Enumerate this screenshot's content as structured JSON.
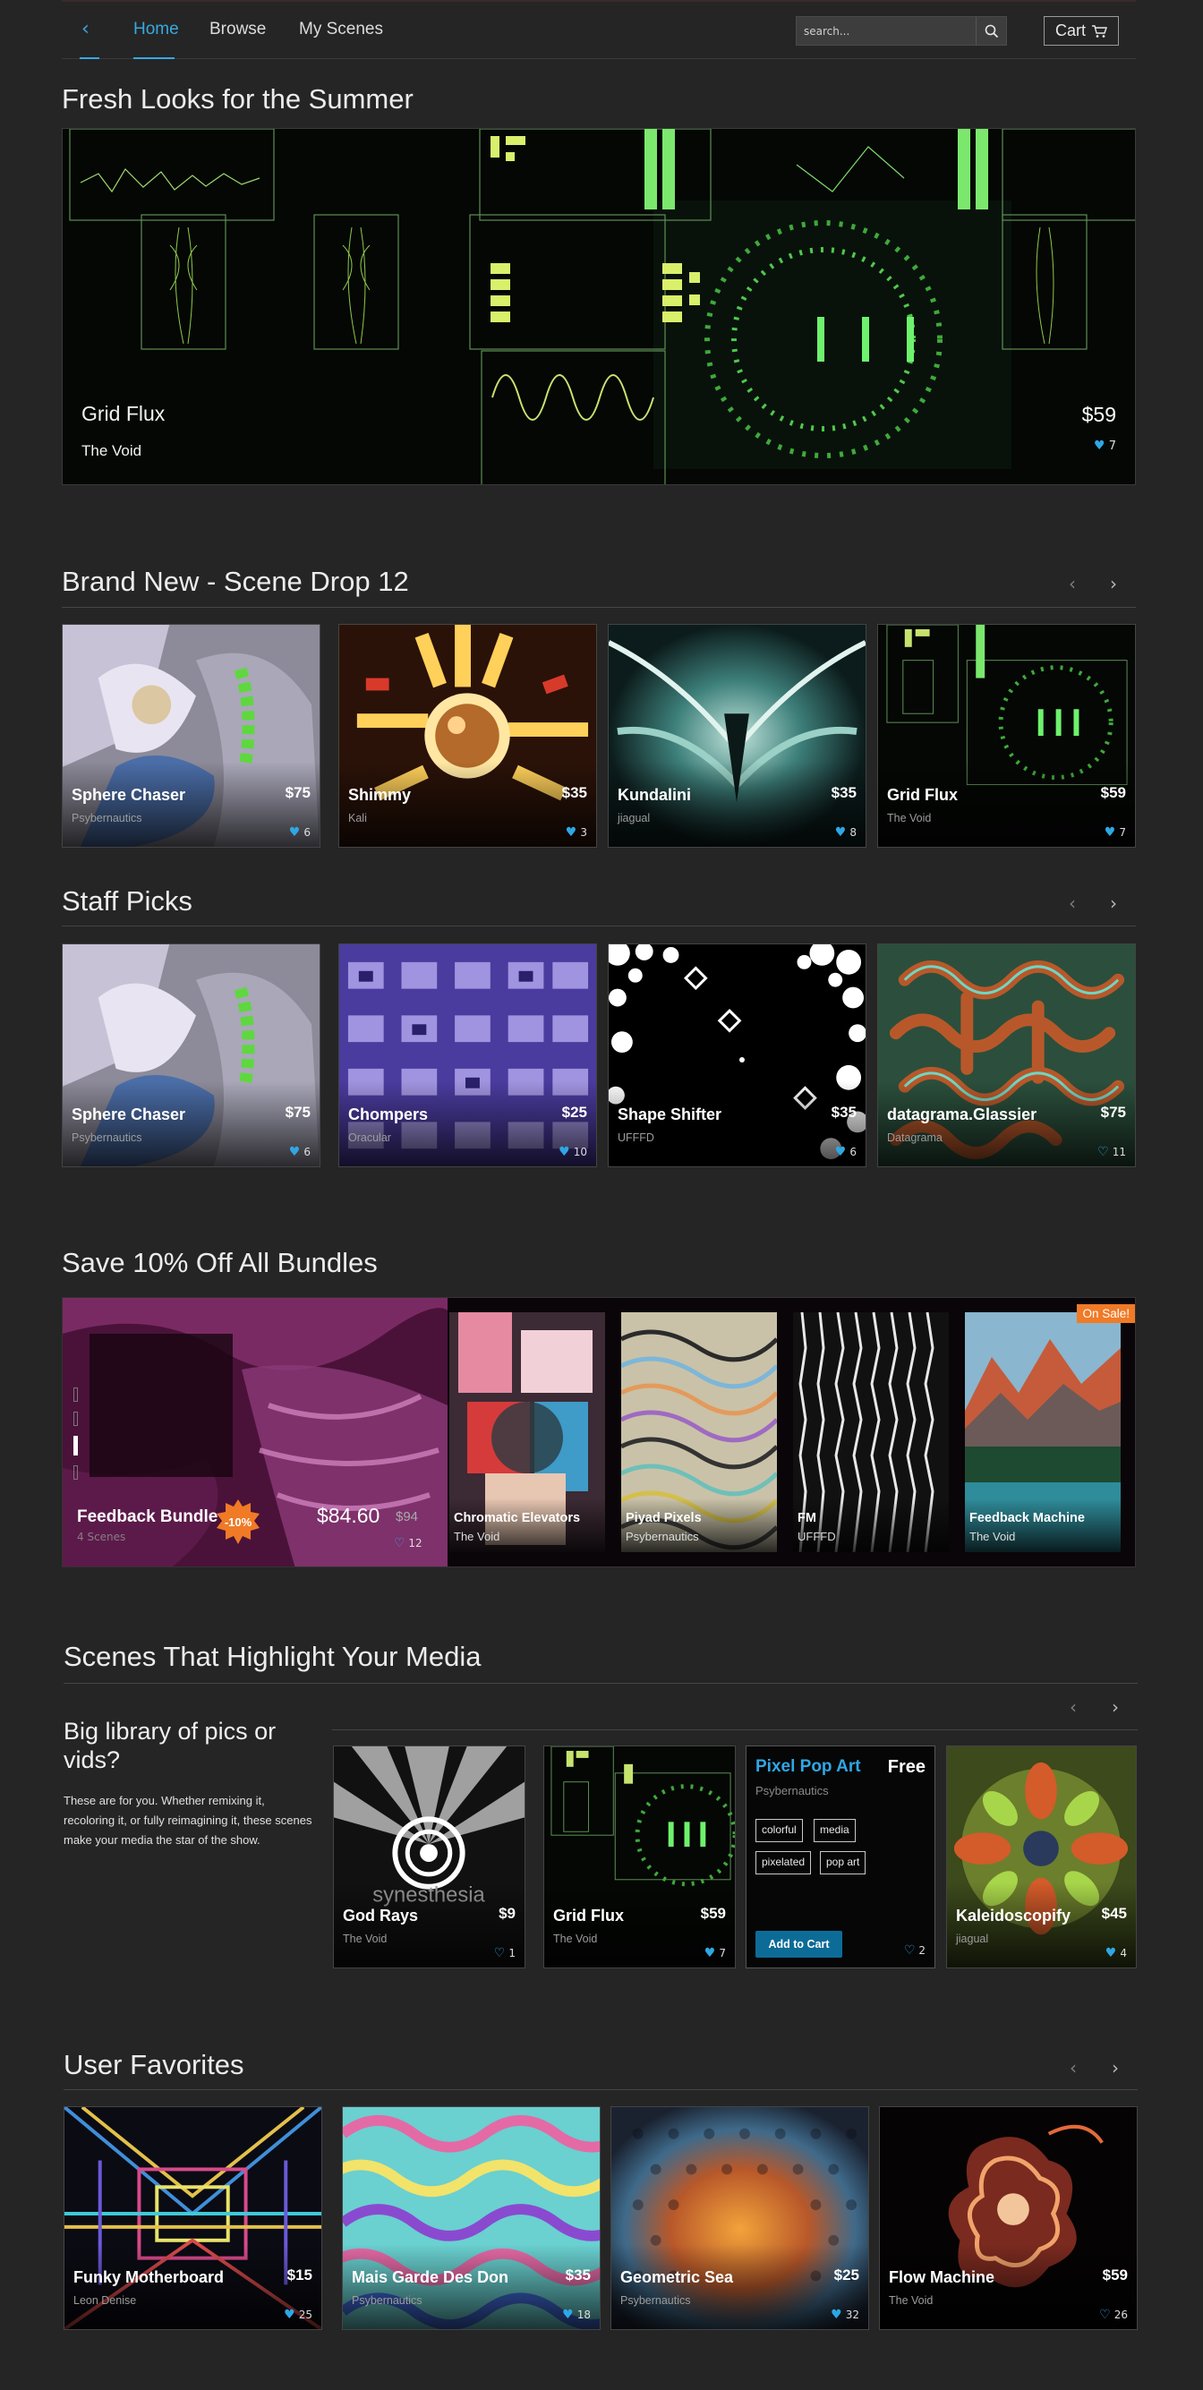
{
  "nav": {
    "links": [
      "Home",
      "Browse",
      "My Scenes"
    ],
    "search_placeholder": "search...",
    "cart_label": "Cart"
  },
  "featured": {
    "heading": "Fresh Looks for the Summer",
    "title": "Grid Flux",
    "artist": "The Void",
    "price": "$59",
    "likes": "7"
  },
  "brand_new": {
    "heading": "Brand New - Scene Drop 12",
    "cards": [
      {
        "title": "Sphere Chaser",
        "artist": "Psybernautics",
        "price": "$75",
        "likes": "6"
      },
      {
        "title": "Shimmy",
        "artist": "Kali",
        "price": "$35",
        "likes": "3"
      },
      {
        "title": "Kundalini",
        "artist": "jiagual",
        "price": "$35",
        "likes": "8"
      },
      {
        "title": "Grid Flux",
        "artist": "The Void",
        "price": "$59",
        "likes": "7"
      }
    ]
  },
  "staff_picks": {
    "heading": "Staff Picks",
    "cards": [
      {
        "title": "Sphere Chaser",
        "artist": "Psybernautics",
        "price": "$75",
        "likes": "6"
      },
      {
        "title": "Chompers",
        "artist": "Oracular",
        "price": "$25",
        "likes": "10"
      },
      {
        "title": "Shape Shifter",
        "artist": "UFFFD",
        "price": "$35",
        "likes": "6"
      },
      {
        "title": "datagrama.Glassier",
        "artist": "Datagrama",
        "price": "$75",
        "likes": "11"
      }
    ]
  },
  "bundles": {
    "heading": "Save 10% Off All Bundles",
    "title": "Feedback Bundle",
    "subtitle": "4 Scenes",
    "badge": "-10%",
    "price": "$84.60",
    "old_price": "$94",
    "likes": "12",
    "on_sale": "On Sale!",
    "items": [
      {
        "title": "Chromatic Elevators",
        "artist": "The Void"
      },
      {
        "title": "Piyad Pixels",
        "artist": "Psybernautics"
      },
      {
        "title": "FM",
        "artist": "UFFFD"
      },
      {
        "title": "Feedback Machine",
        "artist": "The Void"
      }
    ]
  },
  "media": {
    "heading": "Scenes That Highlight Your Media",
    "sub_heading": "Big library of pics or vids?",
    "description": "These are for you. Whether remixing it, recoloring it, or fully reimagining it, these scenes make your media the star of the show.",
    "cards": [
      {
        "title": "God Rays",
        "artist": "The Void",
        "price": "$9",
        "likes": "1",
        "art_text": "synesthesia"
      },
      {
        "title": "Grid Flux",
        "artist": "The Void",
        "price": "$59",
        "likes": "7"
      },
      {
        "title": "Kaleidoscopify",
        "artist": "jiagual",
        "price": "$45",
        "likes": "4"
      }
    ],
    "promo": {
      "title": "Pixel Pop Art",
      "artist": "Psybernautics",
      "price": "Free",
      "tags": [
        "colorful",
        "media",
        "pixelated",
        "pop art"
      ],
      "button": "Add to Cart",
      "likes": "2"
    }
  },
  "user_favorites": {
    "heading": "User Favorites",
    "cards": [
      {
        "title": "Funky Motherboard",
        "artist": "Leon Denise",
        "price": "$15",
        "likes": "25"
      },
      {
        "title": "Mais Garde Des Don",
        "artist": "Psybernautics",
        "price": "$35",
        "likes": "18"
      },
      {
        "title": "Geometric Sea",
        "artist": "Psybernautics",
        "price": "$25",
        "likes": "32"
      },
      {
        "title": "Flow Machine",
        "artist": "The Void",
        "price": "$59",
        "likes": "26"
      }
    ]
  },
  "colors": {
    "accent": "#37a9e0",
    "background": "#252525",
    "sale": "#f07a26",
    "button": "#0d6c97"
  }
}
